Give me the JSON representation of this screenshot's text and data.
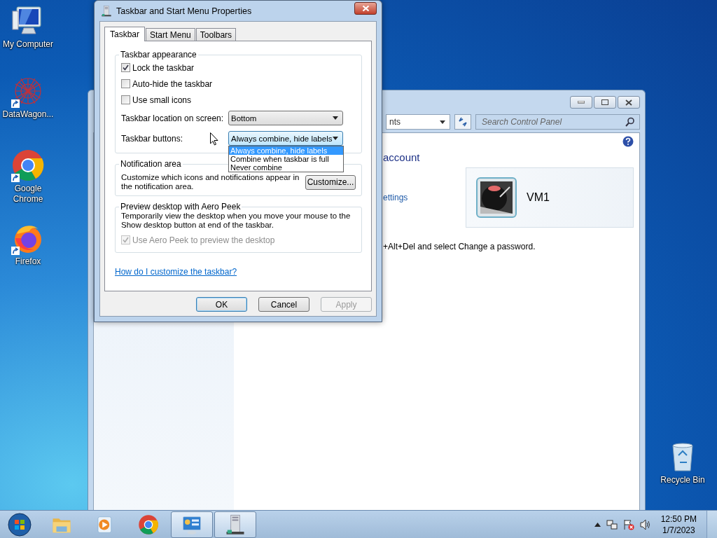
{
  "desktop_icons": [
    {
      "label": "My Computer",
      "kind": "computer",
      "shortcut": false
    },
    {
      "label": "DataWagon...",
      "kind": "network",
      "shortcut": true
    },
    {
      "label": "Google Chrome",
      "kind": "chrome",
      "shortcut": true
    },
    {
      "label": "Firefox",
      "kind": "firefox",
      "shortcut": true
    },
    {
      "label": "Recycle Bin",
      "kind": "bin",
      "shortcut": false
    }
  ],
  "control_panel": {
    "address": "nts",
    "search": {
      "placeholder": "Search Control Panel"
    },
    "heading": "account",
    "link": "ettings",
    "user_name": "VM1",
    "instruction": "+Alt+Del and select Change a password."
  },
  "dialog": {
    "title": "Taskbar and Start Menu Properties",
    "tabs": [
      {
        "label": "Taskbar",
        "selected": true
      },
      {
        "label": "Start Menu",
        "selected": false
      },
      {
        "label": "Toolbars",
        "selected": false
      }
    ],
    "appearance": {
      "title": "Taskbar appearance",
      "checkboxes": [
        {
          "label": "Lock the taskbar",
          "checked": true
        },
        {
          "label": "Auto-hide the taskbar",
          "checked": false
        },
        {
          "label": "Use small icons",
          "checked": false
        }
      ],
      "location": {
        "label": "Taskbar location on screen:",
        "value": "Bottom",
        "expanded": false
      },
      "buttons_setting": {
        "label": "Taskbar buttons:",
        "value": "Always combine, hide labels",
        "expanded": true,
        "options": [
          {
            "label": "Always combine, hide labels",
            "selected": true
          },
          {
            "label": "Combine when taskbar is full",
            "selected": false
          },
          {
            "label": "Never combine",
            "selected": false
          }
        ]
      }
    },
    "notification": {
      "title": "Notification area",
      "text": "Customize which icons and notifications appear in the notification area.",
      "button": "Customize..."
    },
    "aero_peek": {
      "title": "Preview desktop with Aero Peek",
      "text": "Temporarily view the desktop when you move your mouse to the Show desktop button at end of the taskbar.",
      "checkbox": {
        "label": "Use Aero Peek to preview the desktop",
        "checked": true,
        "disabled": true
      }
    },
    "help_link": "How do I customize the taskbar?",
    "buttons": [
      {
        "label": "OK",
        "default": true,
        "disabled": false
      },
      {
        "label": "Cancel",
        "default": false,
        "disabled": false
      },
      {
        "label": "Apply",
        "default": false,
        "disabled": true
      }
    ]
  },
  "taskbar": {
    "apps": [
      {
        "kind": "folder",
        "active": false
      },
      {
        "kind": "media",
        "active": false
      },
      {
        "kind": "chrome",
        "active": false
      },
      {
        "kind": "control-panel",
        "active": true
      },
      {
        "kind": "properties",
        "active": true
      }
    ],
    "clock": {
      "time": "12:50 PM",
      "date": "1/7/2023"
    }
  }
}
